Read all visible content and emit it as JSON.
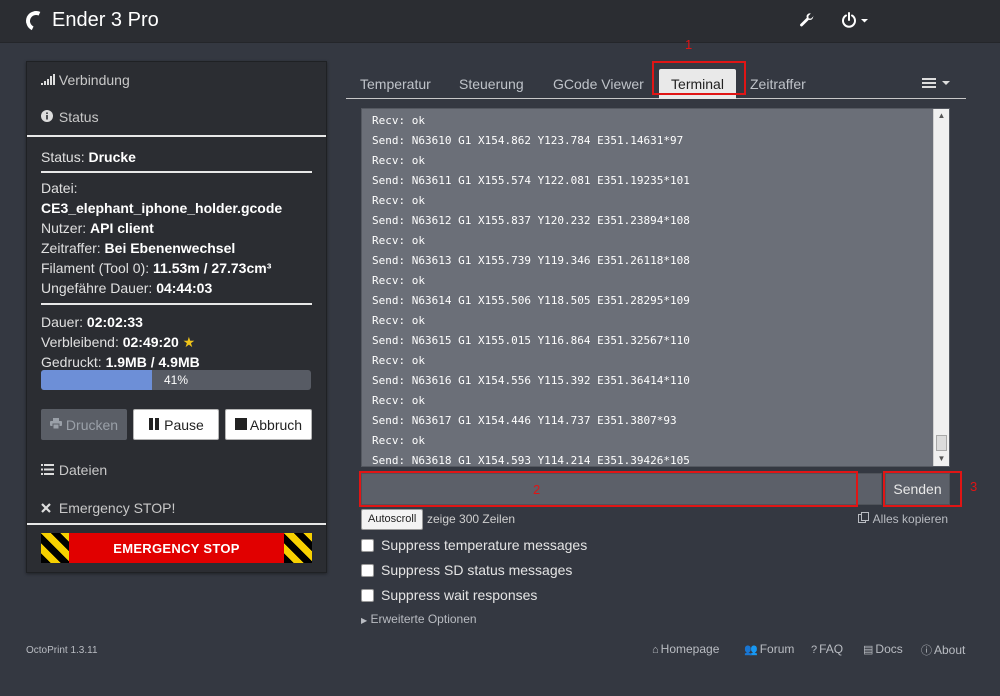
{
  "navbar": {
    "brand": "Ender 3 Pro",
    "wrench_icon": "wrench-icon",
    "power_icon": "power-icon"
  },
  "sidebar": {
    "connection_label": "Verbindung",
    "status_heading": "Status",
    "status_label": "Status:",
    "status_value": "Drucke",
    "file_label": "Datei:",
    "file_name": "CE3_elephant_iphone_holder.gcode",
    "user_label": "Nutzer:",
    "user_value": "API client",
    "timelapse_label": "Zeitraffer:",
    "timelapse_value": "Bei Ebenenwechsel",
    "filament_label": "Filament (Tool 0):",
    "filament_value": "11.53m / 27.73cm³",
    "est_label": "Ungefähre Dauer:",
    "est_value": "04:44:03",
    "duration_label": "Dauer:",
    "duration_value": "02:02:33",
    "remaining_label": "Verbleibend:",
    "remaining_value": "02:49:20",
    "remaining_star": "★",
    "printed_label": "Gedruckt:",
    "printed_value": "1.9MB / 4.9MB",
    "progress_label": "41%",
    "progress_fraction": 0.41,
    "btn_print": "Drucken",
    "btn_pause": "Pause",
    "btn_cancel": "Abbruch",
    "files_label": "Dateien",
    "estop_heading": "Emergency STOP!",
    "estop_button": "EMERGENCY STOP"
  },
  "tabs": [
    {
      "label": "Temperatur",
      "active": false
    },
    {
      "label": "Steuerung",
      "active": false
    },
    {
      "label": "GCode Viewer",
      "active": false
    },
    {
      "label": "Terminal",
      "active": true
    },
    {
      "label": "Zeitraffer",
      "active": false
    }
  ],
  "annotations": {
    "one": "1",
    "two": "2",
    "three": "3"
  },
  "terminal": {
    "lines": [
      "Recv: ok",
      "Send: N63610 G1 X154.862 Y123.784 E351.14631*97",
      "Recv: ok",
      "Send: N63611 G1 X155.574 Y122.081 E351.19235*101",
      "Recv: ok",
      "Send: N63612 G1 X155.837 Y120.232 E351.23894*108",
      "Recv: ok",
      "Send: N63613 G1 X155.739 Y119.346 E351.26118*108",
      "Recv: ok",
      "Send: N63614 G1 X155.506 Y118.505 E351.28295*109",
      "Recv: ok",
      "Send: N63615 G1 X155.015 Y116.864 E351.32567*110",
      "Recv: ok",
      "Send: N63616 G1 X154.556 Y115.392 E351.36414*110",
      "Recv: ok",
      "Send: N63617 G1 X154.446 Y114.737 E351.3807*93",
      "Recv: ok",
      "Send: N63618 G1 X154.593 Y114.214 E351.39426*105"
    ],
    "input_value": "",
    "send_label": "Senden",
    "autoscroll_label": "Autoscroll",
    "lines_info": "zeige 300 Zeilen",
    "copy_all": "Alles kopieren"
  },
  "options": {
    "suppress_temp": "Suppress temperature messages",
    "suppress_sd": "Suppress SD status messages",
    "suppress_wait": "Suppress wait responses",
    "advanced": "Erweiterte Optionen"
  },
  "footer": {
    "version": "OctoPrint 1.3.11",
    "homepage": "Homepage",
    "forum": "Forum",
    "faq": "FAQ",
    "docs": "Docs",
    "about": "About"
  },
  "colors": {
    "background": "#343841",
    "panel": "#2b2d32",
    "progress": "#6d8fd7",
    "annotation_red": "#e01515",
    "estop_red": "#e10000"
  }
}
